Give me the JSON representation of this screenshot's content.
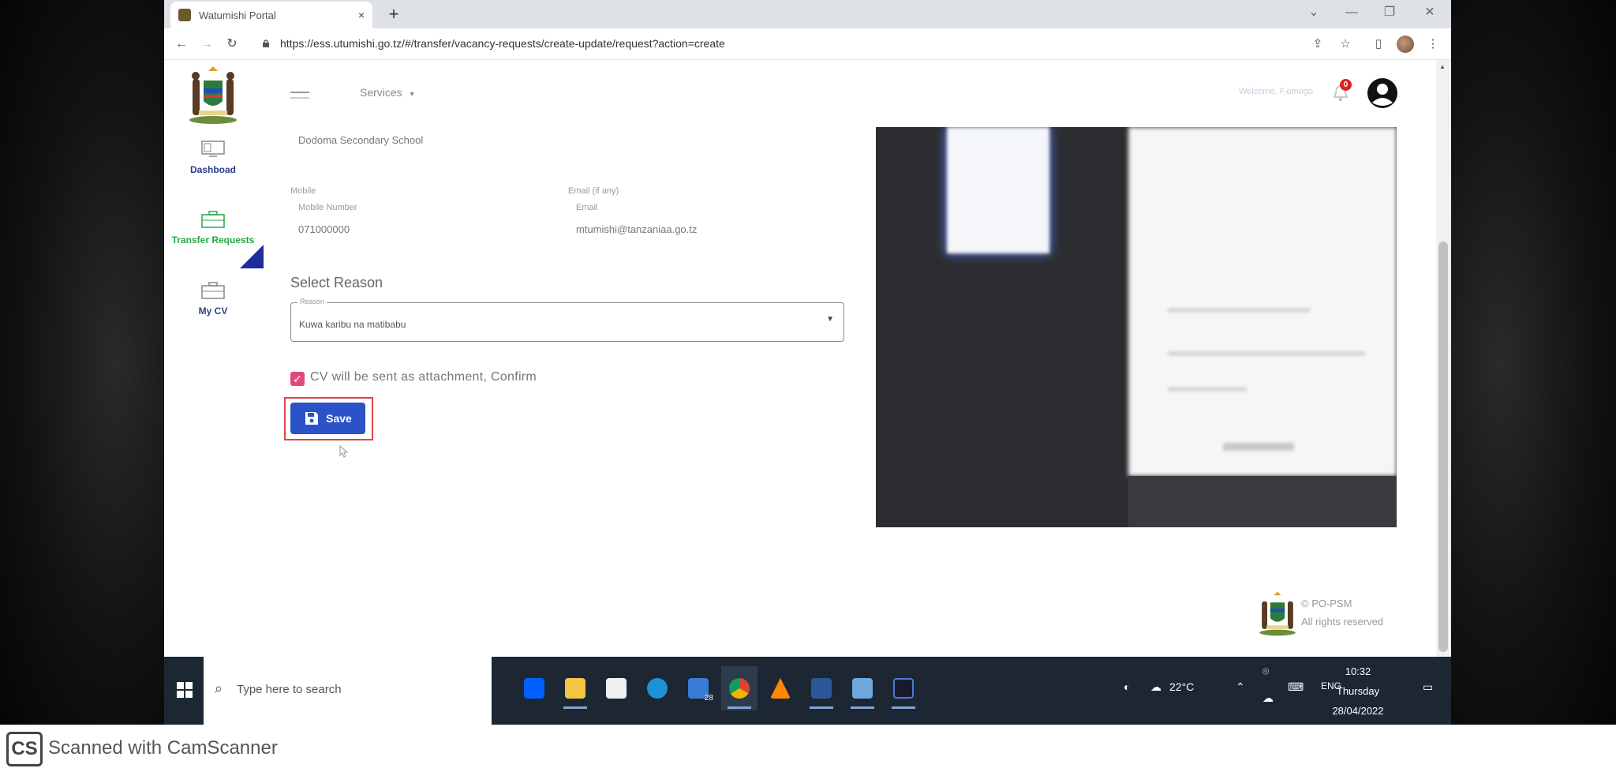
{
  "browser": {
    "tab_title": "Watumishi Portal",
    "tab_close": "×",
    "new_tab": "+",
    "url": "https://ess.utumishi.go.tz/#/transfer/vacancy-requests/create-update/request?action=create"
  },
  "sidebar": {
    "items": [
      {
        "label": "Dashboad",
        "icon": "monitor-icon"
      },
      {
        "label": "Transfer Requests",
        "icon": "briefcase-icon"
      },
      {
        "label": "My CV",
        "icon": "briefcase-icon"
      }
    ]
  },
  "topbar": {
    "services_label": "Services",
    "welcome_text": "Welcome, F.omogo",
    "notification_count": "0"
  },
  "form": {
    "school": "Dodoma Secondary School",
    "mobile_section": "Mobile",
    "mobile_label": "Mobile Number",
    "mobile_value": "071000000",
    "email_section": "Email (if any)",
    "email_label": "Email",
    "email_value": "mtumishi@tanzaniaa.go.tz",
    "select_reason_title": "Select Reason",
    "reason_label": "Reason",
    "reason_value": "Kuwa karibu na matibabu",
    "confirm_label": "CV will be sent as attachment, Confirm",
    "confirm_checked": true,
    "save_label": "Save"
  },
  "footer": {
    "line1": "© PO-PSM",
    "line2": "All rights reserved"
  },
  "taskbar": {
    "search_placeholder": "Type here to search",
    "mail_badge": "28",
    "temperature": "22°C",
    "language": "ENG",
    "time": "10:32",
    "day": "Thursday",
    "date": "28/04/2022"
  },
  "watermark": {
    "logo": "CS",
    "text": "Scanned with CamScanner"
  },
  "colors": {
    "primary": "#2b52c6",
    "active_nav": "#28a745",
    "nav_text": "#2b3f87",
    "checkbox": "#e04a7a",
    "highlight": "#dd4444"
  }
}
